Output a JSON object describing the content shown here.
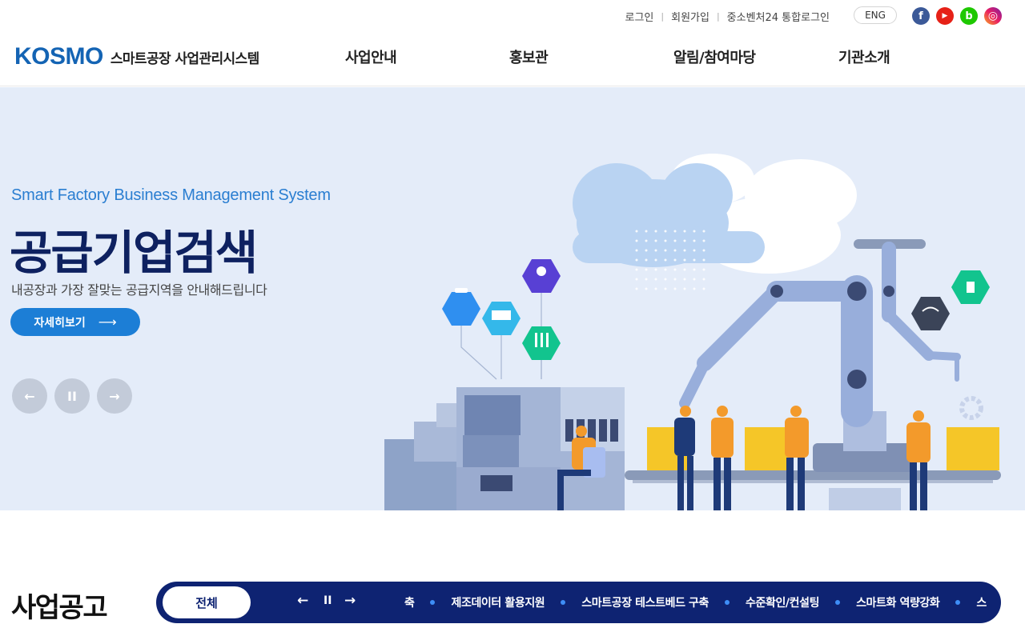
{
  "utility": {
    "links": [
      "로그인",
      "회원가입",
      "중소벤처24 통합로그인"
    ],
    "lang": "ENG",
    "social": [
      {
        "name": "facebook-icon",
        "glyph": "f"
      },
      {
        "name": "youtube-icon",
        "glyph": "▶"
      },
      {
        "name": "blog-icon",
        "glyph": "b"
      },
      {
        "name": "instagram-icon",
        "glyph": "◎"
      }
    ]
  },
  "header": {
    "logo_mark": "KOSMO",
    "logo_text": "스마트공장 사업관리시스템",
    "nav": [
      "사업안내",
      "홍보관",
      "알림/참여마당",
      "기관소개"
    ]
  },
  "hero": {
    "subtitle": "Smart Factory Business Management System",
    "title": "공급기업검색",
    "description": "내공장과 가장 잘맞는 공급지역을 안내해드립니다",
    "button_label": "자세히보기",
    "button_arrow": "⟶",
    "controls": {
      "prev": "←",
      "pause": "II",
      "next": "→"
    }
  },
  "notice": {
    "title": "사업공고",
    "all_label": "전체",
    "controls": {
      "prev": "←",
      "pause": "II",
      "next": "→"
    },
    "ticker": [
      "축",
      "제조데이터 활용지원",
      "스마트공장 테스트베드 구축",
      "수준확인/컨설팅",
      "스마트화 역량강화",
      "스"
    ]
  },
  "colors": {
    "brand": "#1464b4",
    "hero_bg": "#e4ecf9",
    "navy": "#0e2372",
    "accent": "#1c7ed6"
  }
}
